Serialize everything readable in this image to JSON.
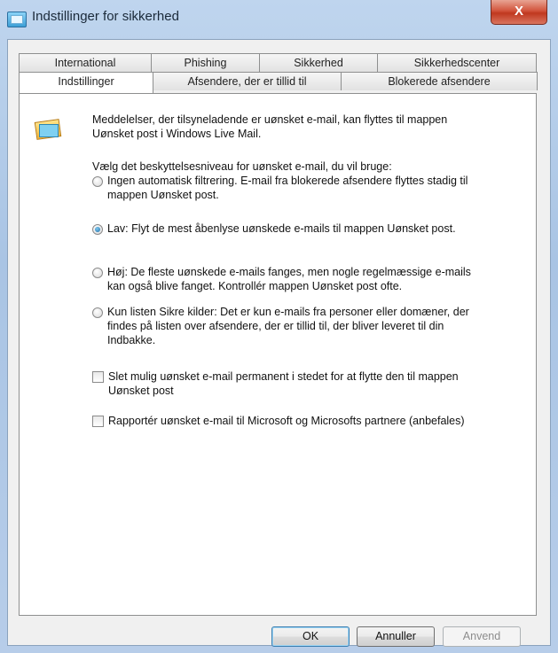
{
  "window": {
    "title": "Indstillinger for sikkerhed",
    "close_label": "X"
  },
  "tabs": {
    "back_row": [
      "International",
      "Phishing",
      "Sikkerhed",
      "Sikkerhedscenter"
    ],
    "front_row": [
      "Indstillinger",
      "Afsendere, der er tillid til",
      "Blokerede afsendere"
    ],
    "active": "Indstillinger"
  },
  "panel": {
    "info_line1": "Meddelelser, der tilsyneladende er uønsket e-mail, kan flyttes til mappen",
    "info_line2": "Uønsket post i Windows Live Mail.",
    "prompt": "Vælg det beskyttelsesniveau for uønsket e-mail, du vil bruge:",
    "options": [
      {
        "line1": "Ingen automatisk filtrering. E-mail fra blokerede afsendere flyttes stadig til",
        "line2": "mappen Uønsket post.",
        "line3": "",
        "selected": false
      },
      {
        "line1": "Lav: Flyt de mest åbenlyse uønskede e-mails til mappen Uønsket post.",
        "line2": "",
        "line3": "",
        "selected": true
      },
      {
        "line1": "Høj: De fleste uønskede e-mails fanges, men nogle regelmæssige e-mails",
        "line2": "kan også blive fanget. Kontrollér mappen Uønsket post ofte.",
        "line3": "",
        "selected": false
      },
      {
        "line1": "Kun listen Sikre kilder: Det er kun e-mails fra personer eller domæner, der",
        "line2": "findes på listen over afsendere, der er tillid til, der bliver leveret til din",
        "line3": "Indbakke.",
        "selected": false
      }
    ],
    "checkboxes": [
      {
        "line1": "Slet mulig uønsket e-mail permanent i stedet for at flytte den til mappen",
        "line2": "Uønsket post",
        "checked": false
      },
      {
        "line1": "Rapportér uønsket e-mail til Microsoft og Microsofts partnere (anbefales)",
        "line2": "",
        "checked": false
      }
    ]
  },
  "buttons": {
    "ok": "OK",
    "cancel": "Annuller",
    "apply": "Anvend"
  }
}
